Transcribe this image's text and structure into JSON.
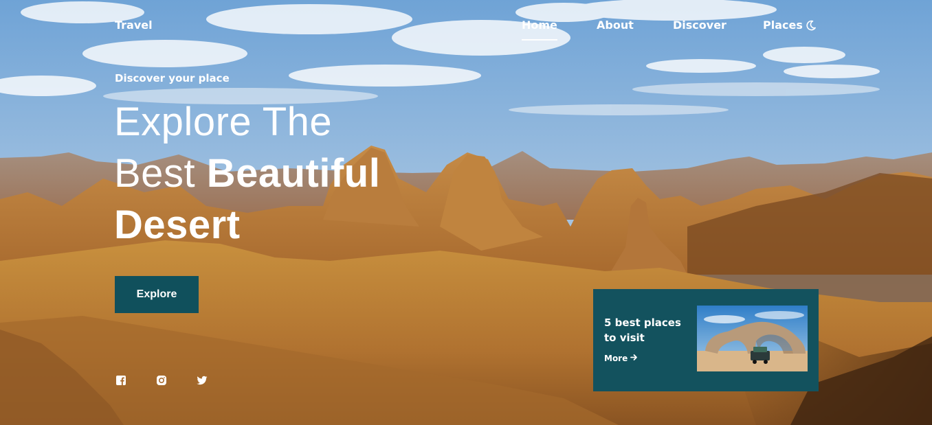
{
  "header": {
    "logo": "Travel",
    "nav": [
      {
        "label": "Home",
        "active": true
      },
      {
        "label": "About",
        "active": false
      },
      {
        "label": "Discover",
        "active": false
      },
      {
        "label": "Places",
        "active": false
      }
    ],
    "theme_icon": "moon-icon"
  },
  "hero": {
    "subtitle": "Discover your place",
    "title_line1": "Explore The",
    "title_line2_regular": "Best",
    "title_line2_bold": "Beautiful",
    "title_line3_bold": "Desert",
    "cta_label": "Explore"
  },
  "social": [
    {
      "icon": "facebook-icon"
    },
    {
      "icon": "instagram-icon"
    },
    {
      "icon": "twitter-icon"
    }
  ],
  "card": {
    "title": "5 best places to visit",
    "more_label": "More",
    "more_icon": "arrow-right-icon",
    "image": "desert-arch-with-car"
  },
  "colors": {
    "accent": "#13525e",
    "button": "#10505c",
    "text": "#ffffff"
  }
}
